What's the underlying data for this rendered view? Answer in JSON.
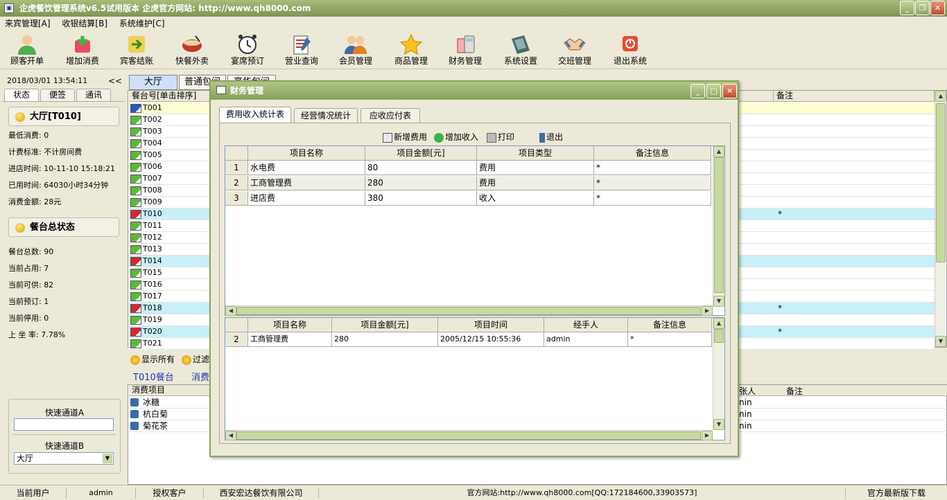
{
  "app": {
    "title": "企虎餐饮管理系统v6.5试用版本  企虎官方网站: http://www.qh8000.com",
    "win_min": "_",
    "win_restore": "❐",
    "win_close": "✕"
  },
  "menu": [
    "来宾管理[A]",
    "收银结算[B]",
    "系统维护[C]"
  ],
  "toolbar": [
    "顾客开单",
    "增加消费",
    "宾客结账",
    "快餐外卖",
    "宴席预订",
    "营业查询",
    "会员管理",
    "商品管理",
    "财务管理",
    "系统设置",
    "交班管理",
    "退出系统"
  ],
  "left": {
    "datetime": "2018/03/01 13:54:11",
    "collapse": "<<",
    "tabs": [
      "状态",
      "便签",
      "通讯"
    ],
    "group1_title": "大厅[T010]",
    "group1": [
      "最低消费: 0",
      "计费标准: 不计房间费",
      "进店时间: 10-11-10 15:18:21",
      "已用时间: 64030小时34分钟",
      "消费金额: 28元"
    ],
    "group2_title": "餐台总状态",
    "group2": [
      "餐台总数: 90",
      "当前占用: 7",
      "当前可供: 82",
      "当前预订: 1",
      "当前停用: 0",
      "上 坐 率: 7.78%"
    ],
    "quick_a": "快速通道A",
    "quick_b": "快速通道B",
    "quick_b_value": "大厅"
  },
  "main": {
    "tabs": [
      "大厅",
      "普通包间",
      "豪华包间"
    ],
    "col_table": "餐台号[单击排序]",
    "col_note": "备注",
    "rows": [
      {
        "id": "T001",
        "note": "",
        "state": "blue"
      },
      {
        "id": "T002",
        "note": "",
        "state": "green"
      },
      {
        "id": "T003",
        "note": "",
        "state": "green"
      },
      {
        "id": "T004",
        "note": "",
        "state": "green"
      },
      {
        "id": "T005",
        "note": "",
        "state": "green"
      },
      {
        "id": "T006",
        "note": "",
        "state": "green"
      },
      {
        "id": "T007",
        "note": "",
        "state": "green"
      },
      {
        "id": "T008",
        "note": "",
        "state": "green"
      },
      {
        "id": "T009",
        "note": "",
        "state": "green"
      },
      {
        "id": "T010",
        "note": "*",
        "state": "red"
      },
      {
        "id": "T011",
        "note": "",
        "state": "green"
      },
      {
        "id": "T012",
        "note": "",
        "state": "green"
      },
      {
        "id": "T013",
        "note": "",
        "state": "green"
      },
      {
        "id": "T014",
        "note": "",
        "state": "red"
      },
      {
        "id": "T015",
        "note": "",
        "state": "green"
      },
      {
        "id": "T016",
        "note": "",
        "state": "green"
      },
      {
        "id": "T017",
        "note": "",
        "state": "green"
      },
      {
        "id": "T018",
        "note": "*",
        "state": "red"
      },
      {
        "id": "T019",
        "note": "",
        "state": "green"
      },
      {
        "id": "T020",
        "note": "*",
        "state": "red"
      },
      {
        "id": "T021",
        "note": "",
        "state": "green"
      }
    ],
    "show_all": "显示所有",
    "filter": "过滤",
    "selected_table": "T010餐台",
    "consume_label": "消费",
    "col_consume": "消费项目",
    "col_handler_partial": "张人",
    "col_note2": "备注",
    "consume_items": [
      {
        "name": "冰糖",
        "handler": "nin"
      },
      {
        "name": "杭白菊",
        "handler": "nin"
      },
      {
        "name": "菊花茶",
        "handler": "nin"
      }
    ]
  },
  "dialog": {
    "title": "财务管理",
    "tabs": [
      "费用收入统计表",
      "经营情况统计",
      "应收应付表"
    ],
    "actions": [
      "新增费用",
      "增加收入",
      "打印",
      "退出"
    ],
    "grid1_cols": [
      "项目名称",
      "项目金额[元]",
      "项目类型",
      "备注信息"
    ],
    "grid1_rows": [
      {
        "n": "1",
        "name": "水电费",
        "amount": "80",
        "type": "费用",
        "note": "*"
      },
      {
        "n": "2",
        "name": "工商管理费",
        "amount": "280",
        "type": "费用",
        "note": "*"
      },
      {
        "n": "3",
        "name": "进店费",
        "amount": "380",
        "type": "收入",
        "note": "*"
      }
    ],
    "grid2_cols": [
      "项目名称",
      "项目金额[元]",
      "项目时间",
      "经手人",
      "备注信息"
    ],
    "grid2_rows": [
      {
        "n": "2",
        "name": "工商管理费",
        "amount": "280",
        "time": "2005/12/15 10:55:36",
        "handler": "admin",
        "note": "*"
      }
    ]
  },
  "status": {
    "user_label": "当前用户",
    "user": "admin",
    "client_label": "授权客户",
    "client": "西安宏达餐饮有限公司",
    "site": "官方网站:http://www.qh8000.com[QQ:172184600,33903573]",
    "download": "官方最新版下载"
  },
  "colors": {
    "row_highlight": "#c8f0f8",
    "row_selected": "#ffffd2",
    "accent": "#8aa35e"
  }
}
